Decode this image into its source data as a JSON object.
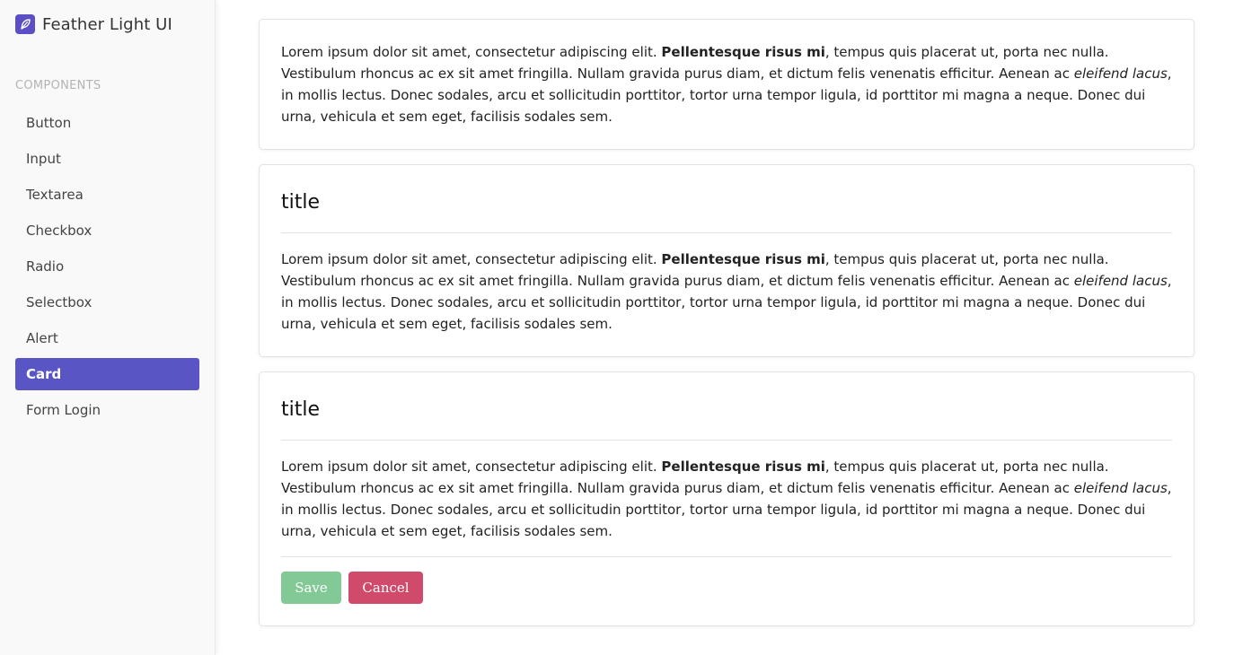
{
  "brand": {
    "title": "Feather Light UI",
    "logo_icon": "feather-icon",
    "accent": "#5a4fc4"
  },
  "sidebar": {
    "section_label": "COMPONENTS",
    "items": [
      {
        "label": "Button"
      },
      {
        "label": "Input"
      },
      {
        "label": "Textarea"
      },
      {
        "label": "Checkbox"
      },
      {
        "label": "Radio"
      },
      {
        "label": "Selectbox"
      },
      {
        "label": "Alert"
      },
      {
        "label": "Card",
        "active": true
      },
      {
        "label": "Form Login"
      }
    ],
    "active_color": "#5a55c5"
  },
  "cards": [
    {
      "body": {
        "before": "Lorem ipsum dolor sit amet, consectetur adipiscing elit. ",
        "bold": "Pellentesque risus mi",
        "middle": ", tempus quis placerat ut, porta nec nulla. Vestibulum rhoncus ac ex sit amet fringilla. Nullam gravida purus diam, et dictum felis venenatis efficitur. Aenean ac ",
        "italic": "eleifend lacus",
        "after": ", in mollis lectus. Donec sodales, arcu et sollicitudin porttitor, tortor urna tempor ligula, id porttitor mi magna a neque. Donec dui urna, vehicula et sem eget, facilisis sodales sem."
      }
    },
    {
      "title": "title",
      "body": {
        "before": "Lorem ipsum dolor sit amet, consectetur adipiscing elit. ",
        "bold": "Pellentesque risus mi",
        "middle": ", tempus quis placerat ut, porta nec nulla. Vestibulum rhoncus ac ex sit amet fringilla. Nullam gravida purus diam, et dictum felis venenatis efficitur. Aenean ac ",
        "italic": "eleifend lacus",
        "after": ", in mollis lectus. Donec sodales, arcu et sollicitudin porttitor, tortor urna tempor ligula, id porttitor mi magna a neque. Donec dui urna, vehicula et sem eget, facilisis sodales sem."
      }
    },
    {
      "title": "title",
      "body": {
        "before": "Lorem ipsum dolor sit amet, consectetur adipiscing elit. ",
        "bold": "Pellentesque risus mi",
        "middle": ", tempus quis placerat ut, porta nec nulla. Vestibulum rhoncus ac ex sit amet fringilla. Nullam gravida purus diam, et dictum felis venenatis efficitur. Aenean ac ",
        "italic": "eleifend lacus",
        "after": ", in mollis lectus. Donec sodales, arcu et sollicitudin porttitor, tortor urna tempor ligula, id porttitor mi magna a neque. Donec dui urna, vehicula et sem eget, facilisis sodales sem."
      },
      "footer": {
        "save_label": "Save",
        "cancel_label": "Cancel",
        "save_color": "#82c995",
        "cancel_color": "#d04a6c"
      }
    }
  ]
}
